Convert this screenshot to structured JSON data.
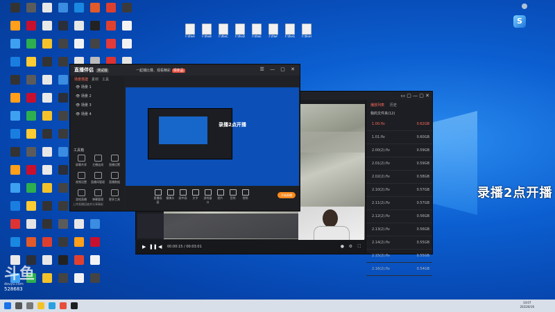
{
  "desktop": {
    "icons": [
      {
        "label": "",
        "color": "#333"
      },
      {
        "label": "",
        "color": "#5b5b5b"
      },
      {
        "label": "",
        "color": "#e7e7e7"
      },
      {
        "label": "",
        "color": "#3a8de0"
      },
      {
        "label": "",
        "color": "#1a88e0"
      },
      {
        "label": "",
        "color": "#e05a2a"
      },
      {
        "label": "",
        "color": "#dd3f2f"
      },
      {
        "label": "",
        "color": "#3a3a3a"
      },
      {
        "label": "",
        "color": "#ff9f1a"
      },
      {
        "label": "",
        "color": "#c8102e"
      },
      {
        "label": "",
        "color": "#e9e9e9"
      },
      {
        "label": "",
        "color": "#2a2f3a"
      },
      {
        "label": "",
        "color": "#e7e7e7"
      },
      {
        "label": "",
        "color": "#222"
      },
      {
        "label": "",
        "color": "#e0412f"
      },
      {
        "label": "",
        "color": "#f2f2f2"
      },
      {
        "label": "",
        "color": "#3ea0f0"
      },
      {
        "label": "",
        "color": "#2dae4f"
      },
      {
        "label": "",
        "color": "#f3c22a"
      },
      {
        "label": "",
        "color": "#444"
      },
      {
        "label": "",
        "color": "#f2f2f2"
      },
      {
        "label": "",
        "color": "#444"
      },
      {
        "label": "",
        "color": "#e23a3a"
      },
      {
        "label": "",
        "color": "#f2f2f2"
      },
      {
        "label": "",
        "color": "#1a7ee0"
      },
      {
        "label": "",
        "color": "#ffcc33"
      },
      {
        "label": "",
        "color": "#333"
      },
      {
        "label": "",
        "color": "#3b3b3b"
      },
      {
        "label": "",
        "color": "#e4e4e4"
      },
      {
        "label": "",
        "color": "#bbb"
      },
      {
        "label": "",
        "color": "#d33"
      },
      {
        "label": "",
        "color": "#e4e4e4"
      }
    ],
    "files": [
      {
        "label": "F:\\fileA"
      },
      {
        "label": "F:\\fileB"
      },
      {
        "label": "F:\\fileC"
      },
      {
        "label": "F:\\fileD"
      },
      {
        "label": "F:\\fileE"
      },
      {
        "label": "F:\\fileF"
      },
      {
        "label": "F:\\fileG"
      },
      {
        "label": "F:\\fileH"
      }
    ],
    "right_text": "录播2点开播"
  },
  "recorder": {
    "app_name": "直播伴侣",
    "version": "测试版",
    "top_message": "一起播比赛、观看精彩",
    "top_highlight": "领奖品",
    "side_tabs": [
      "场景搭建",
      "素材",
      "工具"
    ],
    "scenes": [
      "场景 1",
      "场景 2",
      "场景 3",
      "场景 4"
    ],
    "tools_title": "工具箱",
    "tools": [
      "屏幕共享",
      "主播连线",
      "直播设置",
      "视频设置",
      "直播间管理",
      "直播数据",
      "游戏直播",
      "弹幕管理",
      "更多工具"
    ],
    "bottom_items": [
      "直播画面",
      "摄像头",
      "画中画",
      "文字",
      "游戏窗口",
      "图片",
      "音频",
      "视频"
    ],
    "start_button": "开始直播",
    "footer_text": "上传直播回放并分享精彩",
    "preview_banner": "录播2点开播"
  },
  "player": {
    "time": "00:00:15 / 00:03:01",
    "playlist_tabs": [
      "播放列表",
      "历史"
    ],
    "playlist_sub": "我的文件夹(12)",
    "files": [
      {
        "name": "1.00.flv",
        "size": "0.62GB"
      },
      {
        "name": "1.01.flv",
        "size": "0.60GB"
      },
      {
        "name": "2.00(2).flv",
        "size": "0.59GB"
      },
      {
        "name": "2.01(2).flv",
        "size": "0.59GB"
      },
      {
        "name": "2.02(2).flv",
        "size": "0.58GB"
      },
      {
        "name": "2.10(2).flv",
        "size": "0.57GB"
      },
      {
        "name": "2.11(2).flv",
        "size": "0.57GB"
      },
      {
        "name": "2.12(2).flv",
        "size": "0.56GB"
      },
      {
        "name": "2.13(2).flv",
        "size": "0.56GB"
      },
      {
        "name": "2.14(2).flv",
        "size": "0.55GB"
      },
      {
        "name": "2.15(2).flv",
        "size": "0.55GB"
      },
      {
        "name": "2.16(2).flv",
        "size": "0.54GB"
      }
    ]
  },
  "watermark": {
    "logo_text": "斗鱼",
    "sub": "douyu.com",
    "room": "528683"
  },
  "taskbar": {
    "time": "14:07",
    "date": "2022/6/16"
  },
  "colors": {
    "accent": "#ff6d5a",
    "start": "#ff8a1c",
    "desktop": "#0c5fd1"
  }
}
